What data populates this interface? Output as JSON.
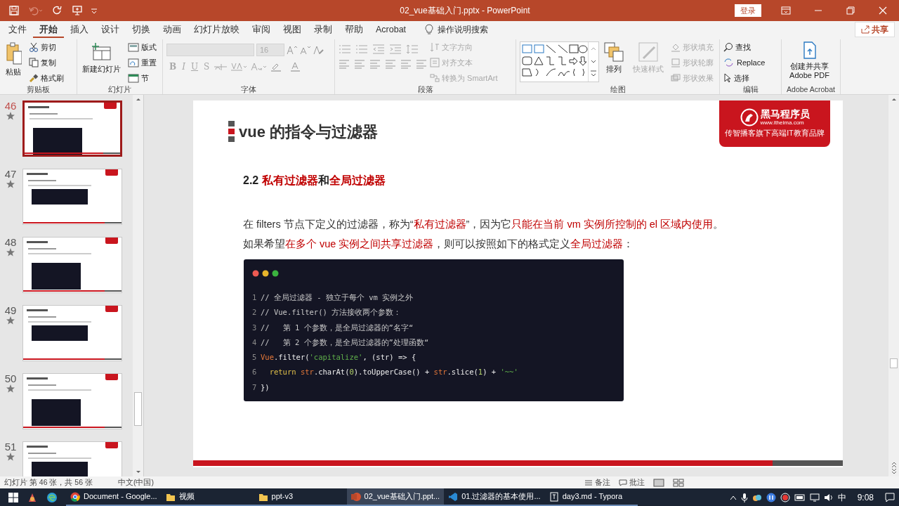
{
  "window": {
    "title": "02_vue基础入门.pptx  -  PowerPoint",
    "sign_in": "登录"
  },
  "menu_tabs": [
    {
      "label": "文件",
      "selected": false
    },
    {
      "label": "开始",
      "selected": true
    },
    {
      "label": "插入",
      "selected": false
    },
    {
      "label": "设计",
      "selected": false
    },
    {
      "label": "切换",
      "selected": false
    },
    {
      "label": "动画",
      "selected": false
    },
    {
      "label": "幻灯片放映",
      "selected": false
    },
    {
      "label": "审阅",
      "selected": false
    },
    {
      "label": "视图",
      "selected": false
    },
    {
      "label": "录制",
      "selected": false
    },
    {
      "label": "帮助",
      "selected": false
    },
    {
      "label": "Acrobat",
      "selected": false
    }
  ],
  "tell_me": "操作说明搜索",
  "share": "共享",
  "ribbon_groups": [
    {
      "label": "剪贴板",
      "kind": "standard",
      "items": [
        {
          "kind": "large",
          "label": "粘贴",
          "disabled": false
        },
        {
          "kind": "small",
          "label": "剪切",
          "disabled": false
        },
        {
          "kind": "small",
          "label": "复制",
          "disabled": false
        },
        {
          "kind": "small",
          "label": "格式刷",
          "disabled": false
        }
      ]
    },
    {
      "label": "幻灯片",
      "kind": "standard",
      "items": [
        {
          "kind": "large",
          "label": "新建幻灯片",
          "disabled": false
        },
        {
          "kind": "small",
          "label": "版式",
          "disabled": false
        },
        {
          "kind": "small",
          "label": "重置",
          "disabled": false
        },
        {
          "kind": "small",
          "label": "节",
          "disabled": false
        }
      ]
    },
    {
      "label": "字体",
      "kind": "font",
      "font_size": "16",
      "format_buttons": [
        {
          "label": "B",
          "disabled": true
        },
        {
          "label": "I",
          "disabled": true
        },
        {
          "label": "U",
          "disabled": true
        },
        {
          "label": "S",
          "disabled": true
        }
      ]
    },
    {
      "label": "段落",
      "kind": "paragraph",
      "items": [
        {
          "kind": "small",
          "label": "文字方向",
          "disabled": true
        },
        {
          "kind": "small",
          "label": "对齐文本",
          "disabled": true
        },
        {
          "kind": "small",
          "label": "转换为 SmartArt",
          "disabled": true
        }
      ]
    },
    {
      "label": "绘图",
      "kind": "drawing",
      "items": [
        {
          "kind": "large",
          "label": "排列",
          "disabled": false
        },
        {
          "kind": "large",
          "label": "快速样式",
          "disabled": true
        },
        {
          "kind": "small",
          "label": "形状填充",
          "disabled": true
        },
        {
          "kind": "small",
          "label": "形状轮廓",
          "disabled": true
        },
        {
          "kind": "small",
          "label": "形状效果",
          "disabled": true
        }
      ]
    },
    {
      "label": "编辑",
      "kind": "standard",
      "items": [
        {
          "kind": "small",
          "label": "查找",
          "disabled": false
        },
        {
          "kind": "small",
          "label": "Replace",
          "disabled": false
        },
        {
          "kind": "small",
          "label": "选择",
          "disabled": false
        }
      ]
    },
    {
      "label": "Adobe Acrobat",
      "kind": "standard",
      "items": [
        {
          "kind": "large",
          "label": "创建并共享 Adobe PDF",
          "disabled": false
        }
      ]
    }
  ],
  "thumbnails": [
    {
      "number": "46",
      "selected": true
    },
    {
      "number": "47",
      "selected": false
    },
    {
      "number": "48",
      "selected": false
    },
    {
      "number": "49",
      "selected": false
    },
    {
      "number": "50",
      "selected": false
    },
    {
      "number": "51",
      "selected": false
    }
  ],
  "slide": {
    "title": "vue 的指令与过滤器",
    "logo": {
      "brand": "黑马程序员",
      "url": "www.itheima.com",
      "tagline": "传智播客旗下高端IT教育品牌"
    },
    "subtitle": [
      {
        "text": "2.2 ",
        "highlight": false
      },
      {
        "text": "私有过滤器",
        "highlight": true
      },
      {
        "text": "和",
        "highlight": false
      },
      {
        "text": "全局过滤器",
        "highlight": true
      }
    ],
    "paragraph": [
      [
        {
          "text": "在 filters 节点下定义的过滤器，称为“",
          "highlight": false
        },
        {
          "text": "私有过滤器",
          "highlight": true
        },
        {
          "text": "”，因为它",
          "highlight": false
        },
        {
          "text": "只能在当前 vm 实例所控制的 el 区域内使用",
          "highlight": true
        },
        {
          "text": "。",
          "highlight": false
        }
      ],
      [
        {
          "text": "如果希望",
          "highlight": false
        },
        {
          "text": "在多个 vue 实例之间共享过滤器",
          "highlight": true
        },
        {
          "text": "，则可以按照如下的格式定义",
          "highlight": false
        },
        {
          "text": "全局过滤器",
          "highlight": true
        },
        {
          "text": "：",
          "highlight": false
        }
      ]
    ],
    "code_lines": [
      {
        "number": "1",
        "tokens": [
          {
            "text": "// 全局过滤器 - 独立于每个 vm 实例之外",
            "kind": "comment"
          }
        ]
      },
      {
        "number": "2",
        "tokens": [
          {
            "text": "// Vue.filter() 方法接收两个参数：",
            "kind": "comment"
          }
        ]
      },
      {
        "number": "3",
        "tokens": [
          {
            "text": "//   第 1 个参数，是全局过滤器的”名字“",
            "kind": "comment"
          }
        ]
      },
      {
        "number": "4",
        "tokens": [
          {
            "text": "//   第 2 个参数，是全局过滤器的”处理函数“",
            "kind": "comment"
          }
        ]
      },
      {
        "number": "5",
        "tokens": [
          {
            "text": "Vue",
            "kind": "variable"
          },
          {
            "text": ".filter(",
            "kind": "plain"
          },
          {
            "text": "'capitalize'",
            "kind": "string"
          },
          {
            "text": ", (str) => {",
            "kind": "plain"
          }
        ]
      },
      {
        "number": "6",
        "tokens": [
          {
            "text": "  return",
            "kind": "keyword"
          },
          {
            "text": " str",
            "kind": "variable"
          },
          {
            "text": ".charAt(",
            "kind": "plain"
          },
          {
            "text": "0",
            "kind": "number"
          },
          {
            "text": ").toUpperCase() + ",
            "kind": "plain"
          },
          {
            "text": "str",
            "kind": "variable"
          },
          {
            "text": ".slice(",
            "kind": "plain"
          },
          {
            "text": "1",
            "kind": "number"
          },
          {
            "text": ") + ",
            "kind": "plain"
          },
          {
            "text": "'~~'",
            "kind": "string"
          }
        ]
      },
      {
        "number": "7",
        "tokens": [
          {
            "text": "})",
            "kind": "plain"
          }
        ]
      }
    ]
  },
  "status_bar": {
    "slide_info": "幻灯片 第 46 张，共 56 张",
    "language": "中文(中国)",
    "notes": "备注",
    "comments": "批注"
  },
  "taskbar": {
    "apps": [
      {
        "label": "Document - Google...",
        "kind": "chrome",
        "selected": false
      },
      {
        "label": "视频",
        "kind": "folder",
        "selected": false
      },
      {
        "label": "ppt-v3",
        "kind": "folder",
        "selected": false
      },
      {
        "label": "02_vue基础入门.ppt...",
        "kind": "powerpoint",
        "selected": true
      },
      {
        "label": "01.过滤器的基本使用...",
        "kind": "vscode",
        "selected": false
      },
      {
        "label": "day3.md - Typora",
        "kind": "typora",
        "selected": false
      }
    ],
    "ime": "中",
    "time": "9:08"
  }
}
